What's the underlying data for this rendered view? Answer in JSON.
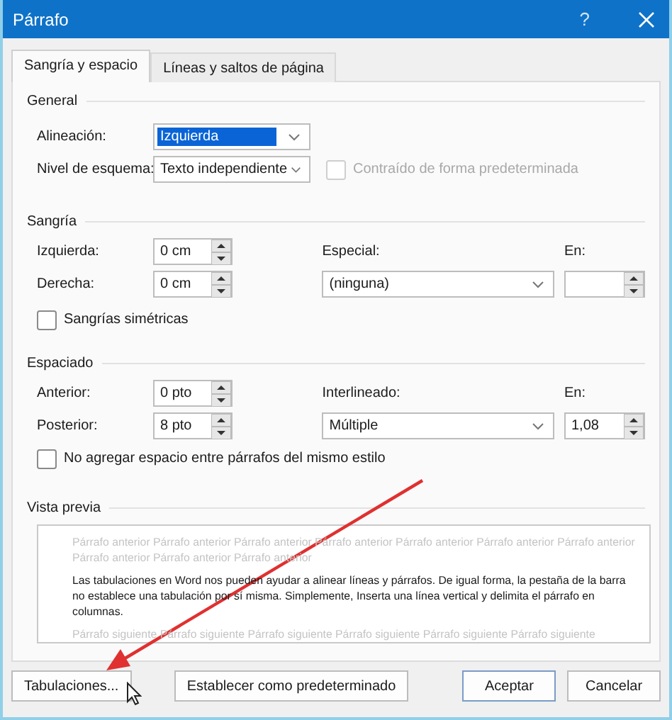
{
  "window": {
    "title": "Párrafo",
    "help": "?"
  },
  "tabs": [
    {
      "label": "Sangría y espacio",
      "selected": true
    },
    {
      "label": "Líneas y saltos de página",
      "selected": false
    }
  ],
  "general": {
    "heading": "General",
    "alignment": {
      "label": "Alineación:",
      "value": "Izquierda",
      "highlighted": true
    },
    "outline_level": {
      "label": "Nivel de esquema:",
      "value": "Texto independiente"
    },
    "collapsed": {
      "label": "Contraído de forma predeterminada",
      "checked": false,
      "disabled": true
    }
  },
  "indentation": {
    "heading": "Sangría",
    "left": {
      "label": "Izquierda:",
      "value": "0 cm"
    },
    "right": {
      "label": "Derecha:",
      "value": "0 cm"
    },
    "special": {
      "label": "Especial:",
      "value": "(ninguna)"
    },
    "by": {
      "label": "En:"
    },
    "mirror": {
      "label": "Sangrías simétricas",
      "checked": false
    }
  },
  "spacing": {
    "heading": "Espaciado",
    "before": {
      "label": "Anterior:",
      "value": "0 pto"
    },
    "after": {
      "label": "Posterior:",
      "value": "8 pto"
    },
    "line_spacing": {
      "label": "Interlineado:",
      "value": "Múltiple"
    },
    "at": {
      "label": "En:",
      "value": "1,08"
    },
    "dont_add": {
      "label": "No agregar espacio entre párrafos del mismo estilo",
      "checked": false
    }
  },
  "preview": {
    "heading": "Vista previa",
    "previous_text": "Párrafo anterior Párrafo anterior Párrafo anterior Párrafo anterior Párrafo anterior Párrafo anterior Párrafo anterior Párrafo anterior Párrafo anterior Párrafo anterior",
    "sample_text": "Las tabulaciones en Word nos pueden ayudar a alinear líneas y párrafos. De igual forma, la pestaña de la barra no establece una tabulación por sí misma. Simplemente, Inserta una línea vertical y delimita el párrafo en columnas.",
    "next_text": "Párrafo siguiente Párrafo siguiente Párrafo siguiente Párrafo siguiente Párrafo siguiente Párrafo siguiente"
  },
  "footer": {
    "left_buttons": [
      {
        "label": "Tabulaciones..."
      },
      {
        "label": "Establecer como predeterminado"
      }
    ],
    "right_buttons": [
      {
        "label": "Aceptar",
        "kind": "primary"
      },
      {
        "label": "Cancelar",
        "kind": "normal"
      }
    ]
  }
}
